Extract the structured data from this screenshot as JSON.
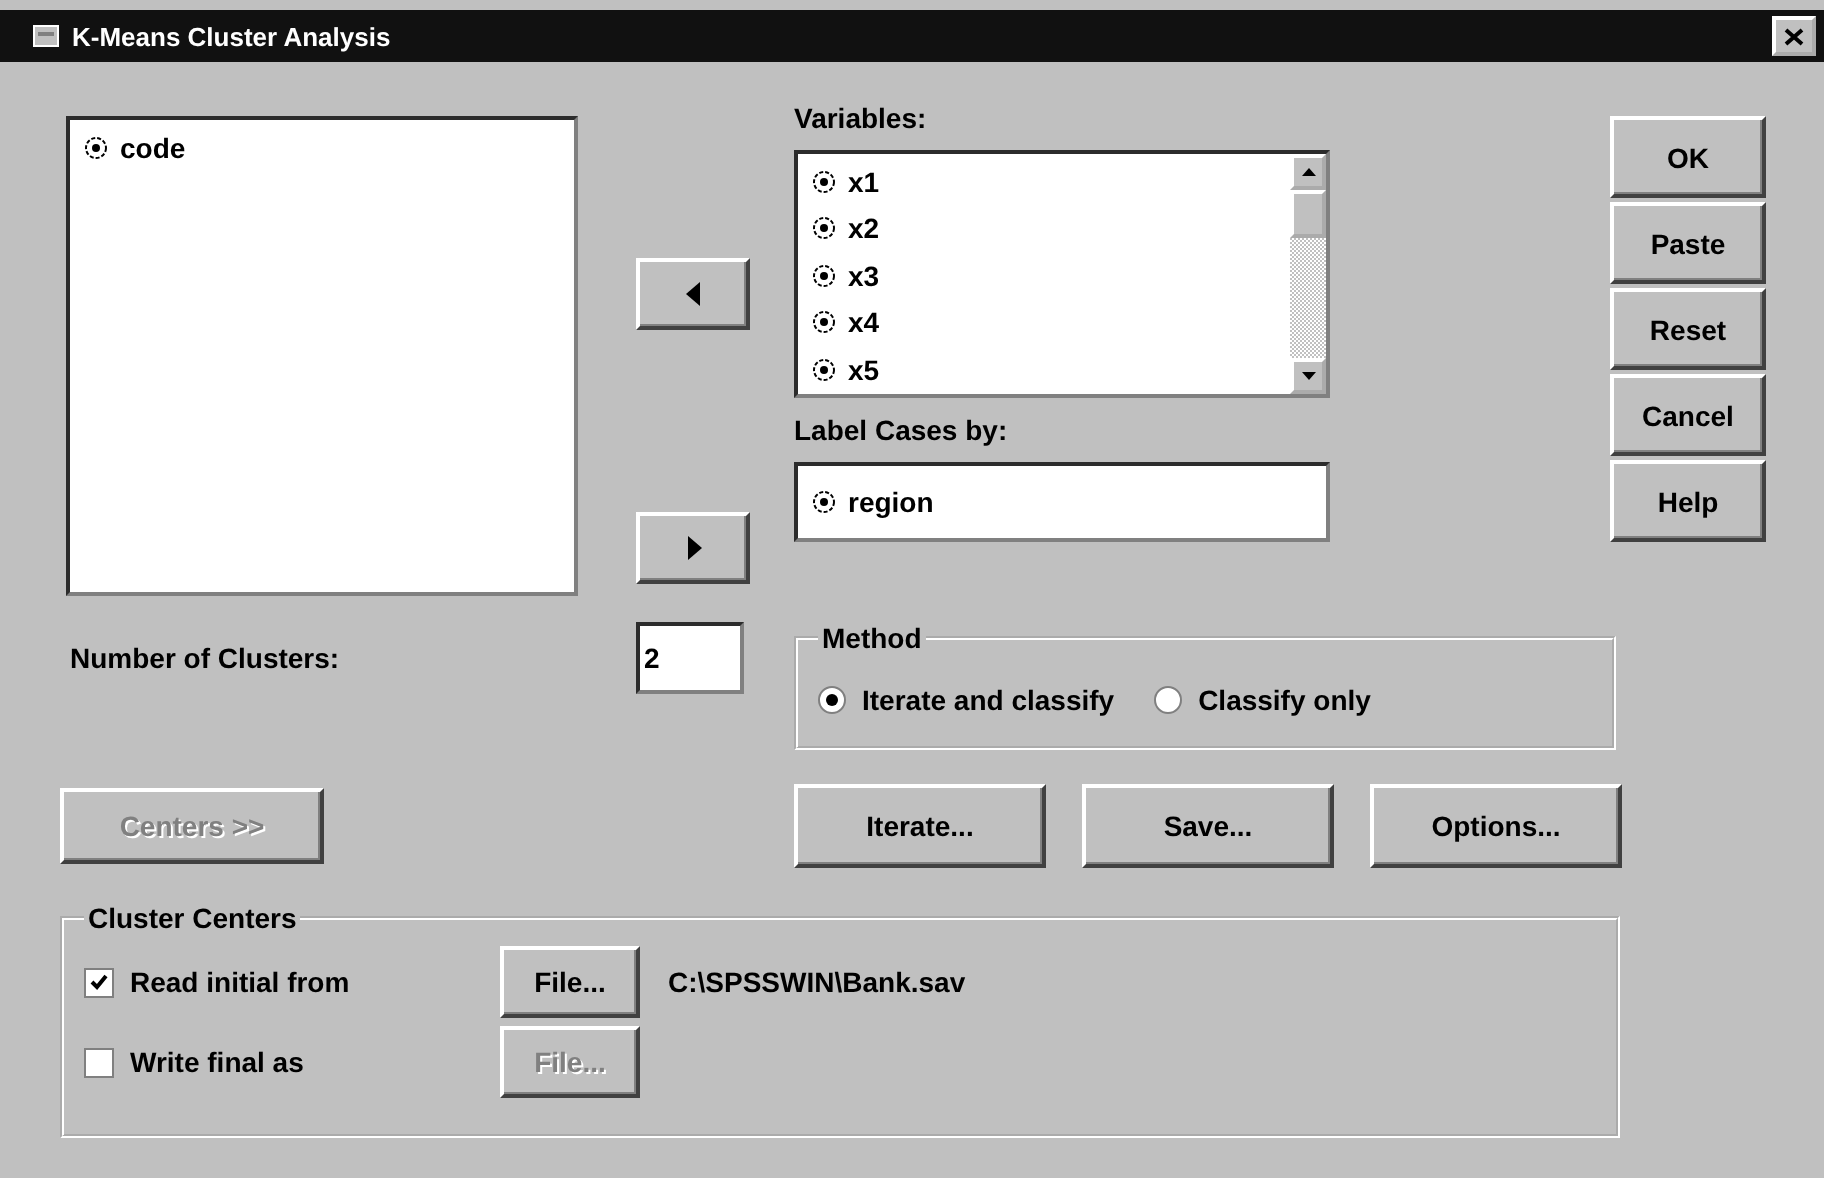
{
  "window": {
    "title": "K-Means Cluster Analysis"
  },
  "source_list": {
    "items": [
      "code"
    ]
  },
  "move_buttons": [
    {
      "kind": "left"
    },
    {
      "kind": "right"
    }
  ],
  "variables": {
    "label": "Variables:",
    "items": [
      "x1",
      "x2",
      "x3",
      "x4",
      "x5"
    ]
  },
  "label_cases": {
    "label": "Label Cases by:",
    "value": "region"
  },
  "actions": [
    {
      "label": "OK"
    },
    {
      "label": "Paste"
    },
    {
      "label": "Reset"
    },
    {
      "label": "Cancel"
    },
    {
      "label": "Help"
    }
  ],
  "clusters": {
    "label": "Number of Clusters:",
    "value": "2"
  },
  "method": {
    "title": "Method",
    "options": [
      {
        "label": "Iterate and classify",
        "selected": true
      },
      {
        "label": "Classify only",
        "selected": false
      }
    ]
  },
  "centers_button": {
    "label": "Centers >>",
    "disabled": true
  },
  "sub_buttons": [
    {
      "label": "Iterate..."
    },
    {
      "label": "Save..."
    },
    {
      "label": "Options..."
    }
  ],
  "cluster_centers": {
    "title": "Cluster Centers",
    "rows": [
      {
        "label": "Read initial from",
        "checked": true,
        "button": "File...",
        "button_disabled": false,
        "path": "C:\\SPSSWIN\\Bank.sav"
      },
      {
        "label": "Write final as",
        "checked": false,
        "button": "File...",
        "button_disabled": true
      }
    ]
  }
}
